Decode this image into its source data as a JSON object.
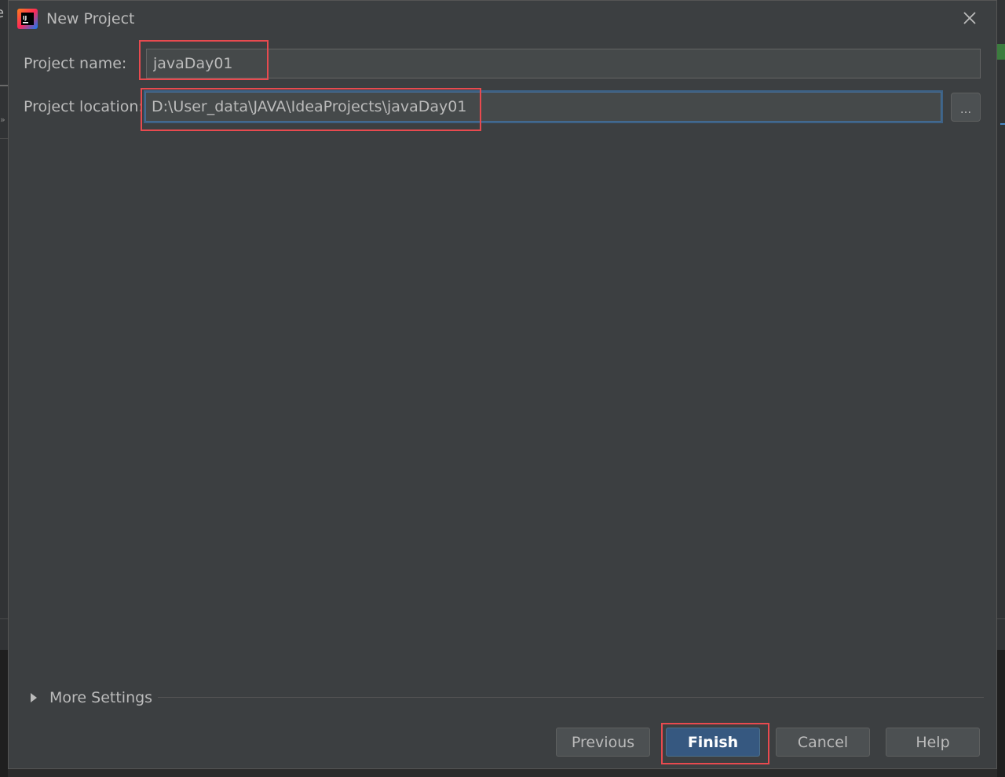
{
  "window": {
    "title": "New Project",
    "icon": "intellij-idea-icon",
    "close_icon": "close-icon"
  },
  "form": {
    "project_name_label": "Project name:",
    "project_name_value": "javaDay01",
    "project_location_label": "Project location:",
    "project_location_value": "D:\\User_data\\JAVA\\IdeaProjects\\javaDay01",
    "browse_label": "..."
  },
  "more_settings": {
    "label": "More Settings",
    "expanded": false
  },
  "buttons": {
    "previous": "Previous",
    "finish": "Finish",
    "cancel": "Cancel",
    "help": "Help"
  },
  "colors": {
    "dialog_bg": "#3c3f41",
    "input_bg": "#45494a",
    "focus_border": "#3d6185",
    "primary_button": "#365880",
    "annotation_highlight": "#e84a4f"
  },
  "background": {
    "edge_text": "e"
  }
}
